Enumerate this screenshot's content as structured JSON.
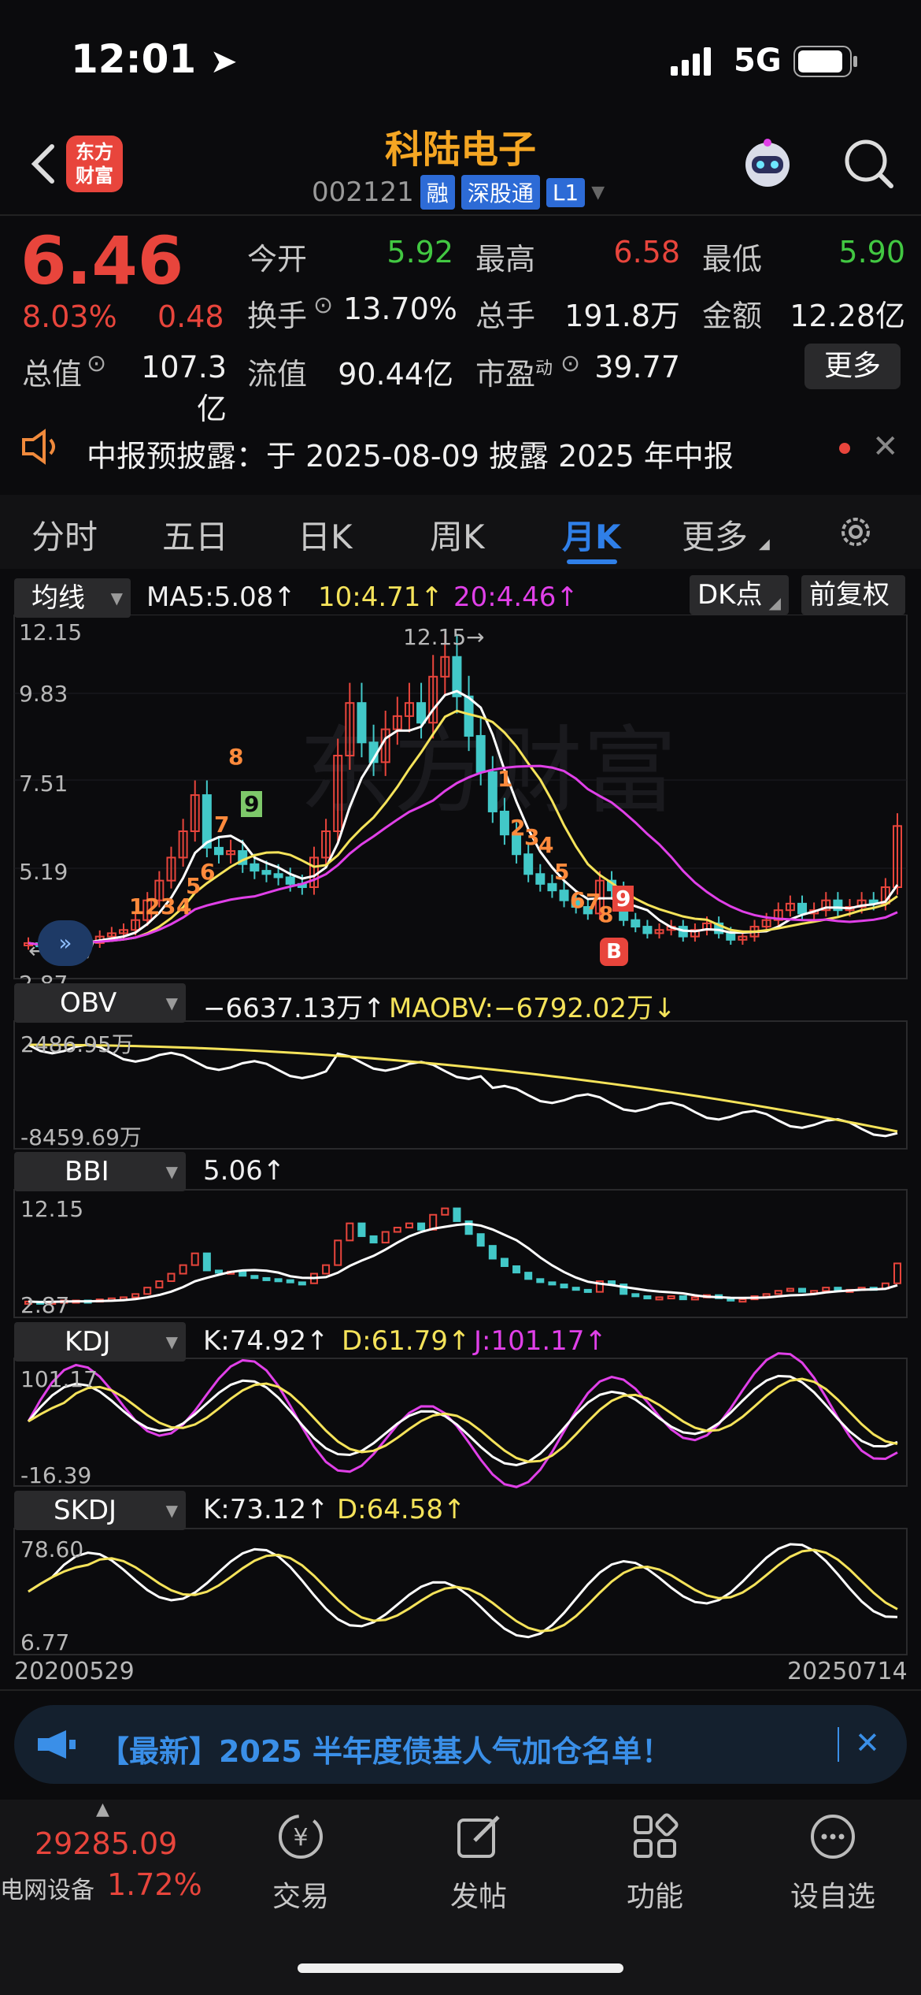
{
  "status_bar": {
    "time": "12:01",
    "network": "5G"
  },
  "header": {
    "logo_line1": "东方",
    "logo_line2": "财富",
    "stock_name": "科陆电子",
    "stock_code": "002121",
    "tags": [
      "融",
      "深股通",
      "L1"
    ]
  },
  "quote": {
    "price": "6.46",
    "change_pct": "8.03%",
    "change": "0.48",
    "open_label": "今开",
    "open": "5.92",
    "high_label": "最高",
    "high": "6.58",
    "low_label": "最低",
    "low": "5.90",
    "turnover_label": "换手",
    "turnover": "13.70%",
    "volume_label": "总手",
    "volume": "191.8万",
    "amount_label": "金额",
    "amount": "12.28亿",
    "mktcap_label": "总值",
    "mktcap": "107.3亿",
    "float_label": "流值",
    "float_cap": "90.44亿",
    "pe_label": "市盈",
    "pe_sup": "动",
    "pe": "39.77",
    "more_label": "更多"
  },
  "notice": {
    "text": "中报预披露：于 2025-08-09 披露 2025 年中报"
  },
  "tabs": [
    {
      "label": "分时"
    },
    {
      "label": "五日"
    },
    {
      "label": "日K"
    },
    {
      "label": "周K"
    },
    {
      "label": "月K"
    },
    {
      "label": "更多"
    }
  ],
  "main_chart": {
    "indicator_label": "均线",
    "ma5": "MA5:5.08",
    "ma10": "10:4.71",
    "ma20": "20:4.46",
    "dk_button": "DK点",
    "adjust_button": "前复权",
    "y_ticks": [
      "12.15",
      "9.83",
      "7.51",
      "5.19"
    ],
    "low_mark": "2.87",
    "low_arrow": "←2.37",
    "high_arrow": "12.15→",
    "td_numbers": [
      "1",
      "2",
      "3",
      "4",
      "5",
      "6",
      "7",
      "8",
      "9",
      "1",
      "2",
      "3",
      "4",
      "5",
      "6",
      "7",
      "8",
      "9"
    ],
    "buy_marker": "B"
  },
  "obv_panel": {
    "indicator_label": "OBV",
    "value": "−6637.13万",
    "maobv": "MAOBV:−6792.02万",
    "top": "2486.95万",
    "bottom": "-8459.69万"
  },
  "bbi_panel": {
    "indicator_label": "BBI",
    "value": "5.06",
    "top": "12.15",
    "bottom": "2.87"
  },
  "kdj_panel": {
    "indicator_label": "KDJ",
    "k": "K:74.92",
    "d": "D:61.79",
    "j": "J:101.17",
    "top": "101.17",
    "bottom": "-16.39"
  },
  "skdj_panel": {
    "indicator_label": "SKDJ",
    "k": "K:73.12",
    "d": "D:64.58",
    "top": "78.60",
    "bottom": "6.77"
  },
  "date_range": {
    "start": "20200529",
    "end": "20250714"
  },
  "banner": {
    "text": "【最新】2025 半年度债基人气加仓名单！"
  },
  "bottom_bar": {
    "index_value": "29285.09",
    "index_name": "电网设备",
    "index_change": "1.72%",
    "items": [
      {
        "label": "交易"
      },
      {
        "label": "发帖"
      },
      {
        "label": "功能"
      },
      {
        "label": "设自选"
      }
    ]
  },
  "colors": {
    "up": "#e8453c",
    "down": "#42c8c8",
    "ma5": "#ffffff",
    "ma10": "#f5e35a",
    "ma20": "#e040e8",
    "accent": "#2f7fe8"
  }
}
